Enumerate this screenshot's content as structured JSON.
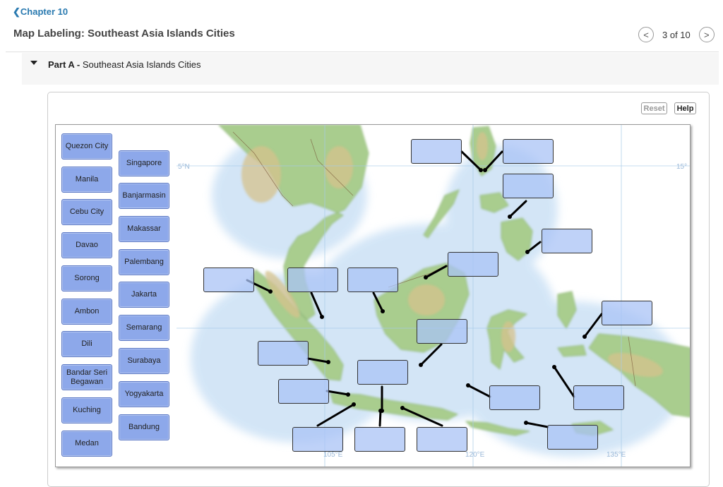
{
  "nav": {
    "back_label": "Chapter 10",
    "back_icon": "chevron-left-icon"
  },
  "header": {
    "title": "Map Labeling: Southeast Asia Islands Cities"
  },
  "pager": {
    "prev_icon": "chevron-left-icon",
    "count": "3 of 10",
    "next_icon": "chevron-right-icon"
  },
  "part": {
    "label": "Part A -",
    "title": "Southeast Asia Islands Cities"
  },
  "toolbar": {
    "reset_label": "Reset",
    "help_label": "Help"
  },
  "labels": {
    "col1": [
      "Quezon City",
      "Manila",
      "Cebu City",
      "Davao",
      "Sorong",
      "Ambon",
      "Dili",
      "Bandar Seri Begawan",
      "Kuching",
      "Medan"
    ],
    "col2": [
      "Singapore",
      "Banjarmasin",
      "Makassar",
      "Palembang",
      "Jakarta",
      "Semarang",
      "Surabaya",
      "Yogyakarta",
      "Bandung"
    ]
  },
  "map": {
    "lat_labels": {
      "west": "5°N",
      "east": "15°"
    },
    "lon_labels": [
      "105°E",
      "120°E",
      "135°E"
    ],
    "colors": {
      "sea": "#dbe9f7",
      "land": "#a9cd8e",
      "highland": "#d6c28c",
      "target": "#aac3f5"
    }
  }
}
